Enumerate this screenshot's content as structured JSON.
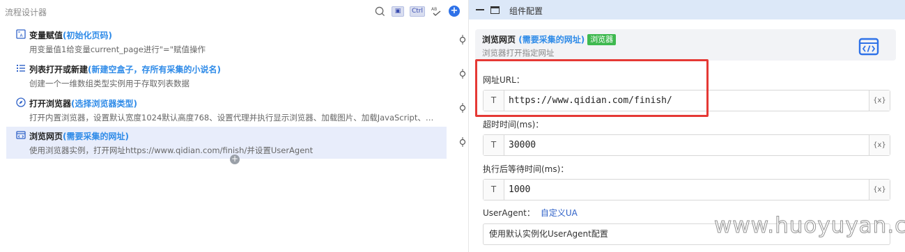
{
  "left_panel": {
    "title": "流程设计器",
    "toolbar": {
      "ctrl_label": "Ctrl",
      "ab_label": "AB"
    },
    "steps": [
      {
        "title": "变量赋值",
        "param": "(初始化页码)",
        "desc": "用变量值1给变量current_page进行\"=\"赋值操作",
        "icon": "variable-assign-icon"
      },
      {
        "title": "列表打开或新建",
        "param": "(新建空盒子，存所有采集的小说名)",
        "desc": "创建一个一维数组类型实例用于存取列表数据",
        "icon": "list-icon"
      },
      {
        "title": "打开浏览器",
        "param": "(选择浏览器类型)",
        "desc": "打开内置浏览器，设置默认宽度1024默认高度768、设置代理并执行显示浏览器、加载图片、加载JavaScript、…",
        "icon": "compass-icon"
      },
      {
        "title": "浏览网页",
        "param": "(需要采集的网址)",
        "desc": "使用浏览器实例，打开网址https://www.qidian.com/finish/并设置UserAgent",
        "icon": "browser-window-icon",
        "active": true
      }
    ]
  },
  "right_panel": {
    "header_title": "组件配置",
    "card": {
      "title": "浏览网页",
      "param": "(需要采集的网址)",
      "badge": "浏览器",
      "desc": "浏览器打开指定网址"
    },
    "fields": {
      "url": {
        "label": "网址URL：",
        "type_tag": "T",
        "value": "https://www.qidian.com/finish/",
        "var_tag": "{x}"
      },
      "timeout": {
        "label": "超时时间(ms)：",
        "type_tag": "T",
        "value": "30000",
        "var_tag": "{x}"
      },
      "wait_after": {
        "label": "执行后等待时间(ms)：",
        "type_tag": "T",
        "value": "1000",
        "var_tag": "{x}"
      },
      "user_agent": {
        "label": "UserAgent：",
        "link": "自定义UA",
        "select_value": "使用默认实例化UserAgent配置"
      }
    }
  },
  "watermark": "www.huoyuyan.com",
  "colors": {
    "accent": "#2f72e8",
    "param_blue": "#2f8be8",
    "badge_green": "#3fb950",
    "highlight_red": "#e53935",
    "right_header_bg": "#dce8f8",
    "active_step_bg": "#e8edfb"
  }
}
